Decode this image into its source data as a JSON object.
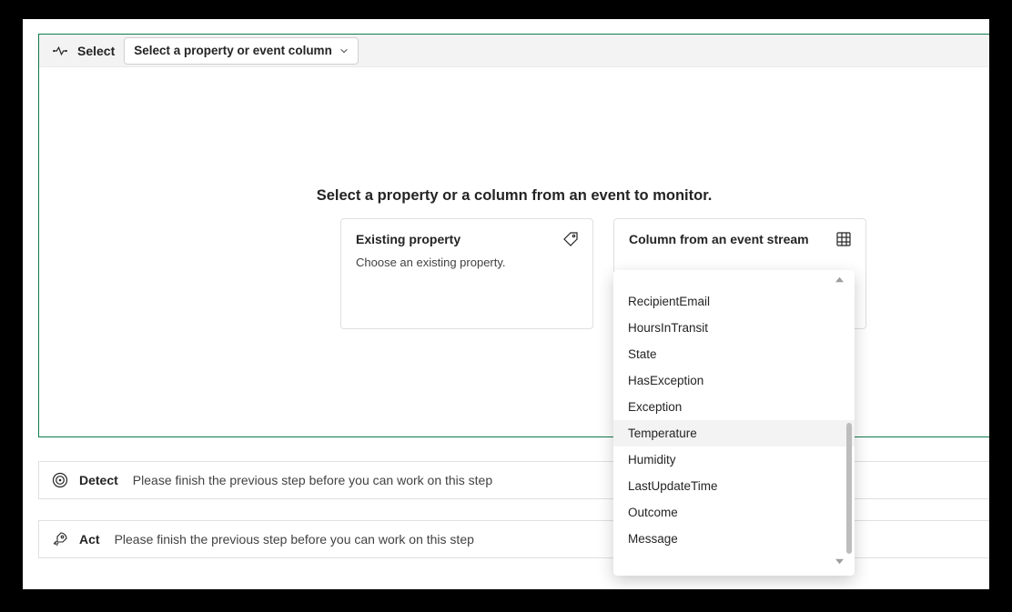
{
  "select": {
    "title": "Select",
    "dropdown_label": "Select a property or event column",
    "headline": "Select a property or a column from an event to monitor.",
    "card_existing": {
      "title": "Existing property",
      "subtitle": "Choose an existing property."
    },
    "card_stream": {
      "title": "Column from an event stream"
    },
    "columns": [
      "RecipientEmail",
      "HoursInTransit",
      "State",
      "HasException",
      "Exception",
      "Temperature",
      "Humidity",
      "LastUpdateTime",
      "Outcome",
      "Message"
    ],
    "hover_index": 5
  },
  "detect": {
    "title": "Detect",
    "message": "Please finish the previous step before you can work on this step"
  },
  "act": {
    "title": "Act",
    "message": "Please finish the previous step before you can work on this step"
  }
}
